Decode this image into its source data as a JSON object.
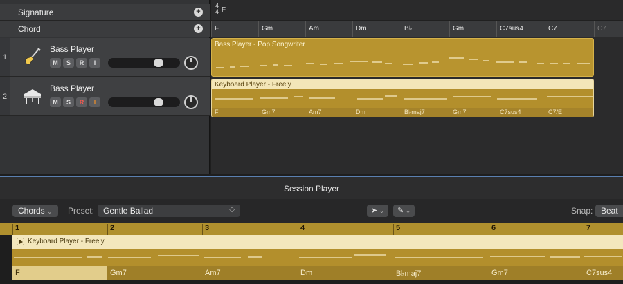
{
  "global_tracks": {
    "signature_label": "Signature",
    "chord_label": "Chord",
    "time_sig_num": "4",
    "time_sig_den": "4",
    "key": "F"
  },
  "tracks": [
    {
      "number": "1",
      "name": "Bass Player",
      "buttons": [
        "M",
        "S",
        "R",
        "I"
      ]
    },
    {
      "number": "2",
      "name": "Bass Player",
      "buttons": [
        "M",
        "S",
        "R",
        "I"
      ]
    }
  ],
  "chord_lane": [
    "F",
    "Gm",
    "Am",
    "Dm",
    "B♭",
    "Gm",
    "C7sus4",
    "C7",
    "C7"
  ],
  "regions": {
    "bass_title": "Bass Player - Pop Songwriter",
    "keys_title": "Keyboard Player - Freely",
    "keys_chords": [
      "F",
      "Gm7",
      "Am7",
      "Dm",
      "B♭maj7",
      "Gm7",
      "C7sus4",
      "C7/E"
    ]
  },
  "session_player": {
    "title": "Session Player",
    "mode": "Chords",
    "preset_label": "Preset:",
    "preset": "Gentle Ballad",
    "snap_label": "Snap:",
    "snap_value": "Beat",
    "bars": [
      "1",
      "2",
      "3",
      "4",
      "5",
      "6",
      "7"
    ],
    "region_title": "Keyboard Player - Freely",
    "chords": [
      "F",
      "Gm7",
      "Am7",
      "Dm",
      "B♭maj7",
      "Gm7",
      "C7sus4"
    ]
  },
  "colors": {
    "region_gold": "#b8942f",
    "region_light": "#f3e6b8",
    "accent_blue": "#5a7fb0"
  }
}
